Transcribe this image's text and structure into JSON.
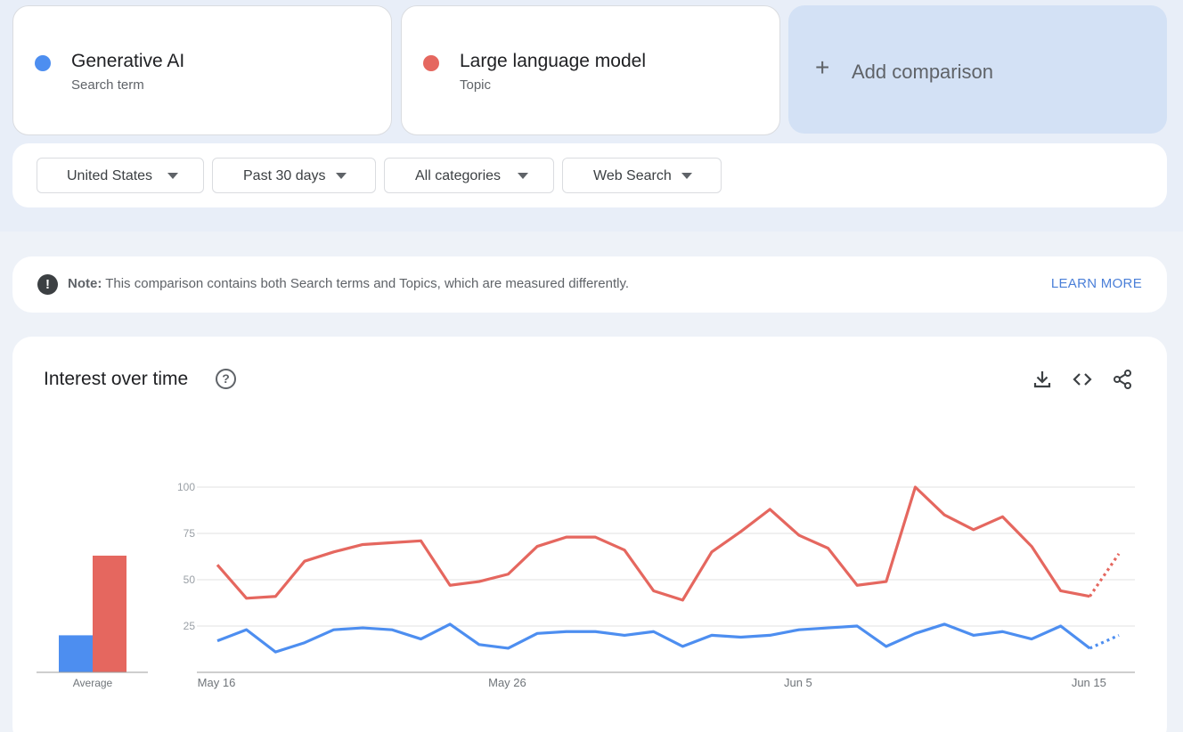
{
  "terms": [
    {
      "name": "Generative AI",
      "type": "Search term",
      "color": "#4d8ef0"
    },
    {
      "name": "Large language model",
      "type": "Topic",
      "color": "#e5675f"
    }
  ],
  "add_comparison": {
    "label": "Add comparison",
    "icon": "plus-icon"
  },
  "filters": [
    {
      "label": "United States",
      "icon": "caret-down-icon"
    },
    {
      "label": "Past 30 days",
      "icon": "caret-down-icon"
    },
    {
      "label": "All categories",
      "icon": "caret-down-icon"
    },
    {
      "label": "Web Search",
      "icon": "caret-down-icon"
    }
  ],
  "note": {
    "icon": "exclamation-icon",
    "bold": "Note:",
    "text": " This comparison contains both Search terms and Topics, which are measured differently.",
    "link": "LEARN MORE"
  },
  "interest": {
    "title": "Interest over time",
    "icons": [
      "help-icon",
      "download-icon",
      "embed-code-icon",
      "share-icon"
    ]
  },
  "chart_data": {
    "type": "line",
    "y_ticks": [
      "100",
      "75",
      "50",
      "25"
    ],
    "ylim": [
      0,
      100
    ],
    "x_ticks": [
      "May 16",
      "May 26",
      "Jun 5",
      "Jun 15"
    ],
    "grid": true,
    "average": {
      "label": "Average",
      "values": [
        20,
        63
      ]
    },
    "series": [
      {
        "color": "#4d8ef0",
        "values": [
          17,
          23,
          11,
          16,
          23,
          24,
          23,
          18,
          26,
          15,
          13,
          21,
          22,
          22,
          20,
          22,
          14,
          20,
          19,
          20,
          23,
          24,
          25,
          14,
          21,
          26,
          20,
          22,
          18,
          25,
          13,
          20
        ],
        "partial_from": 30
      },
      {
        "color": "#e5675f",
        "values": [
          58,
          40,
          41,
          60,
          65,
          69,
          70,
          71,
          47,
          49,
          53,
          68,
          73,
          73,
          66,
          44,
          39,
          65,
          76,
          88,
          74,
          67,
          47,
          49,
          100,
          85,
          77,
          84,
          68,
          44,
          41,
          64
        ],
        "partial_from": 30
      }
    ]
  }
}
